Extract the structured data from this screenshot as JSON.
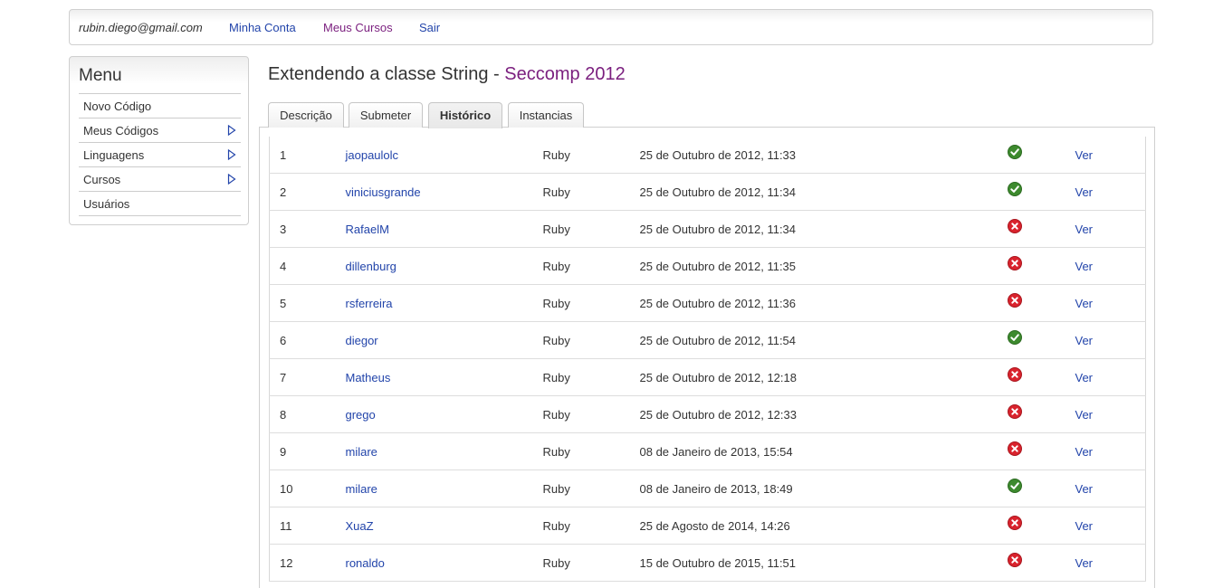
{
  "header": {
    "email": "rubin.diego@gmail.com",
    "nav": [
      {
        "label": "Minha Conta"
      },
      {
        "label": "Meus Cursos"
      },
      {
        "label": "Sair"
      }
    ]
  },
  "sidebar": {
    "title": "Menu",
    "items": [
      {
        "label": "Novo Código",
        "has_submenu": false
      },
      {
        "label": "Meus Códigos",
        "has_submenu": true
      },
      {
        "label": "Linguagens",
        "has_submenu": true
      },
      {
        "label": "Cursos",
        "has_submenu": true
      },
      {
        "label": "Usuários",
        "has_submenu": false
      }
    ]
  },
  "page": {
    "title": "Extendendo a classe String",
    "separator": " - ",
    "course": "Seccomp 2012"
  },
  "tabs": [
    {
      "label": "Descrição",
      "active": false
    },
    {
      "label": "Submeter",
      "active": false
    },
    {
      "label": "Histórico",
      "active": true
    },
    {
      "label": "Instancias",
      "active": false
    }
  ],
  "colors": {
    "link": "#2244aa",
    "visited": "#7a1e7e",
    "success": "#3d8a2e",
    "error": "#d9232d"
  },
  "history": {
    "rows": [
      {
        "num": "1",
        "user": "jaopaulolc",
        "language": "Ruby",
        "date": "25 de Outubro de 2012, 11:33",
        "status": "success-icon",
        "action": "Ver"
      },
      {
        "num": "2",
        "user": "viniciusgrande",
        "language": "Ruby",
        "date": "25 de Outubro de 2012, 11:34",
        "status": "success-icon",
        "action": "Ver"
      },
      {
        "num": "3",
        "user": "RafaelM",
        "language": "Ruby",
        "date": "25 de Outubro de 2012, 11:34",
        "status": "error-icon",
        "action": "Ver"
      },
      {
        "num": "4",
        "user": "dillenburg",
        "language": "Ruby",
        "date": "25 de Outubro de 2012, 11:35",
        "status": "error-icon",
        "action": "Ver"
      },
      {
        "num": "5",
        "user": "rsferreira",
        "language": "Ruby",
        "date": "25 de Outubro de 2012, 11:36",
        "status": "error-icon",
        "action": "Ver"
      },
      {
        "num": "6",
        "user": "diegor",
        "language": "Ruby",
        "date": "25 de Outubro de 2012, 11:54",
        "status": "success-icon",
        "action": "Ver"
      },
      {
        "num": "7",
        "user": "Matheus",
        "language": "Ruby",
        "date": "25 de Outubro de 2012, 12:18",
        "status": "error-icon",
        "action": "Ver"
      },
      {
        "num": "8",
        "user": "grego",
        "language": "Ruby",
        "date": "25 de Outubro de 2012, 12:33",
        "status": "error-icon",
        "action": "Ver"
      },
      {
        "num": "9",
        "user": "milare",
        "language": "Ruby",
        "date": "08 de Janeiro de 2013, 15:54",
        "status": "error-icon",
        "action": "Ver"
      },
      {
        "num": "10",
        "user": "milare",
        "language": "Ruby",
        "date": "08 de Janeiro de 2013, 18:49",
        "status": "success-icon",
        "action": "Ver"
      },
      {
        "num": "11",
        "user": "XuaZ",
        "language": "Ruby",
        "date": "25 de Agosto de 2014, 14:26",
        "status": "error-icon",
        "action": "Ver"
      },
      {
        "num": "12",
        "user": "ronaldo",
        "language": "Ruby",
        "date": "15 de Outubro de 2015, 11:51",
        "status": "error-icon",
        "action": "Ver"
      }
    ]
  }
}
